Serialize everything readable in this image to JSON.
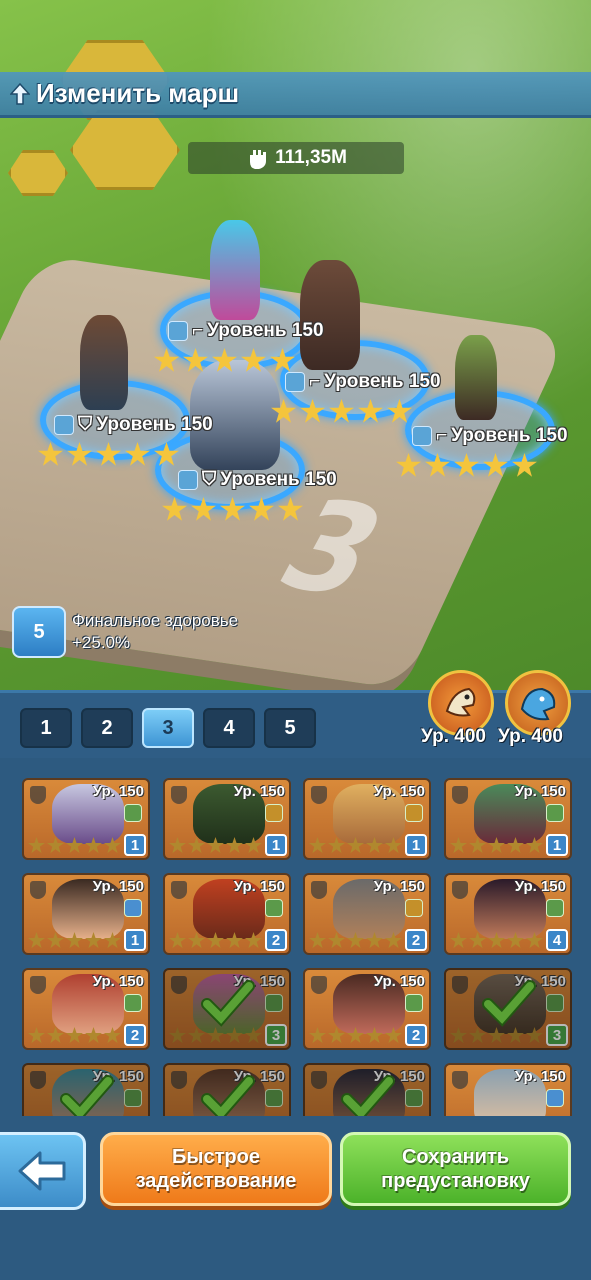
{
  "header": {
    "title": "Изменить марш"
  },
  "power": {
    "value": "111,35M"
  },
  "formation_number": "3",
  "heroes_on_field": [
    {
      "level_label": "Уровень 150",
      "stars": 5
    },
    {
      "level_label": "Уровень 150",
      "stars": 5
    },
    {
      "level_label": "Уровень 150",
      "stars": 5
    },
    {
      "level_label": "Уровень 150",
      "stars": 5
    },
    {
      "level_label": "Уровень 150",
      "stars": 5
    }
  ],
  "bonus": {
    "icon_value": "5",
    "label": "Финальное здоровье",
    "value": "+25.0%"
  },
  "tabs": [
    {
      "label": "1"
    },
    {
      "label": "2"
    },
    {
      "label": "3",
      "active": true
    },
    {
      "label": "4"
    },
    {
      "label": "5"
    }
  ],
  "pets": [
    {
      "name": "eagle-pet",
      "level": "Ур. 400"
    },
    {
      "name": "dragon-pet",
      "level": "Ур. 400"
    }
  ],
  "cards": [
    {
      "level": "Ур. 150",
      "count": "1",
      "selected": false
    },
    {
      "level": "Ур. 150",
      "count": "1",
      "selected": false
    },
    {
      "level": "Ур. 150",
      "count": "1",
      "selected": false
    },
    {
      "level": "Ур. 150",
      "count": "1",
      "selected": false
    },
    {
      "level": "Ур. 150",
      "count": "1",
      "selected": false
    },
    {
      "level": "Ур. 150",
      "count": "2",
      "selected": false
    },
    {
      "level": "Ур. 150",
      "count": "2",
      "selected": false
    },
    {
      "level": "Ур. 150",
      "count": "4",
      "selected": false
    },
    {
      "level": "Ур. 150",
      "count": "2",
      "selected": false
    },
    {
      "level": "Ур. 150",
      "count": "3",
      "selected": true
    },
    {
      "level": "Ур. 150",
      "count": "2",
      "selected": false
    },
    {
      "level": "Ур. 150",
      "count": "3",
      "selected": true
    },
    {
      "level": "Ур. 150",
      "count": "",
      "selected": true
    },
    {
      "level": "Ур. 150",
      "count": "",
      "selected": true
    },
    {
      "level": "Ур. 150",
      "count": "",
      "selected": true
    },
    {
      "level": "Ур. 150",
      "count": "",
      "selected": false
    }
  ],
  "buttons": {
    "quick_deploy_line1": "Быстрое",
    "quick_deploy_line2": "задействование",
    "save_preset_line1": "Сохранить",
    "save_preset_line2": "предустановку"
  }
}
